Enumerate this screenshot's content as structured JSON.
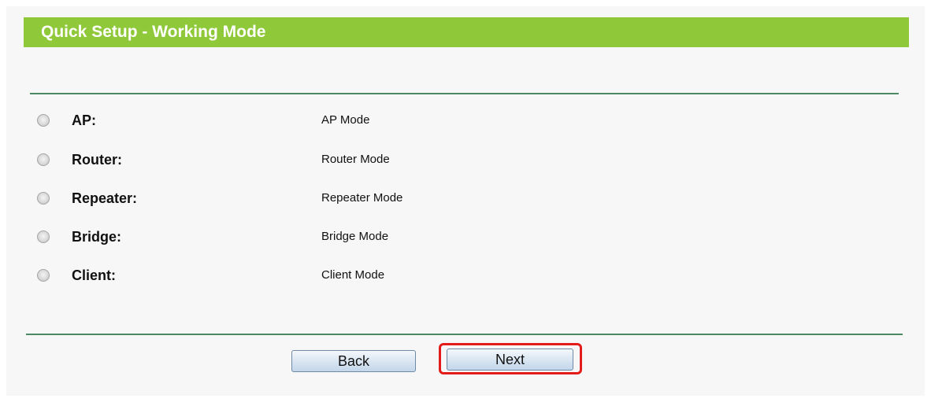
{
  "header": {
    "title": "Quick Setup - Working Mode"
  },
  "modes": [
    {
      "label": "AP:",
      "description": "AP Mode",
      "selected": false
    },
    {
      "label": "Router:",
      "description": "Router Mode",
      "selected": false
    },
    {
      "label": "Repeater:",
      "description": "Repeater Mode",
      "selected": false
    },
    {
      "label": "Bridge:",
      "description": "Bridge Mode",
      "selected": false
    },
    {
      "label": "Client:",
      "description": "Client Mode",
      "selected": false
    }
  ],
  "buttons": {
    "back_label": "Back",
    "next_label": "Next"
  },
  "colors": {
    "header_green": "#8fc93a",
    "rule_green": "#4c8a66",
    "highlight_red": "#e31b1b"
  }
}
